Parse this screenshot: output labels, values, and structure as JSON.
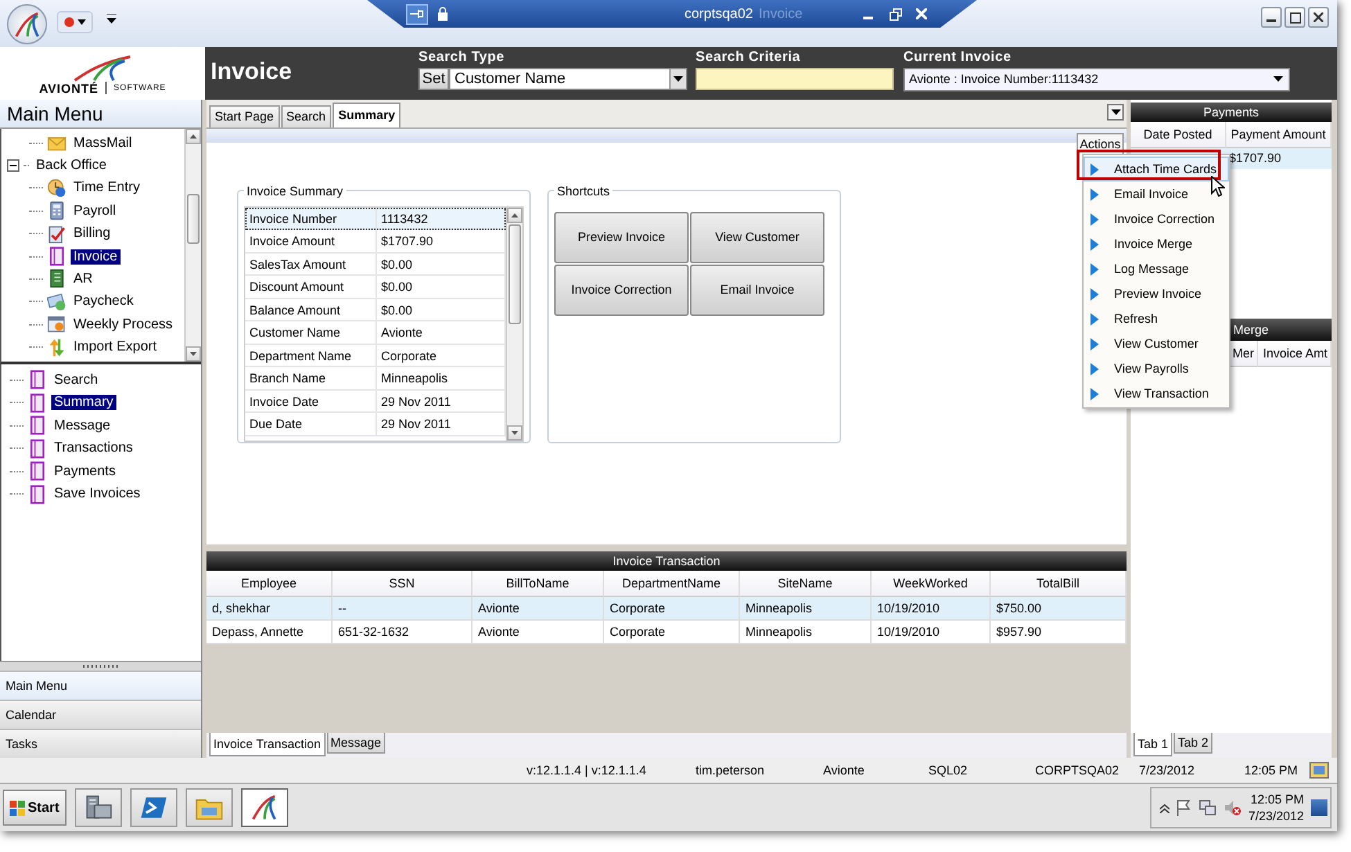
{
  "title_bar": {
    "host": "corptsqa02",
    "document": "Invoice"
  },
  "header": {
    "brand": "AVIONTÉ",
    "tagline": "SOFTWARE",
    "title": "Invoice",
    "search_type": {
      "label": "Search Type",
      "button": "Set",
      "value": "Customer Name"
    },
    "search_criteria": {
      "label": "Search Criteria"
    },
    "current_invoice": {
      "label": "Current Invoice",
      "value": "Avionte : Invoice Number:1113432"
    }
  },
  "sidebar": {
    "title": "Main Menu",
    "tree": [
      {
        "label": "MassMail",
        "kind": "mail",
        "selected": false
      },
      {
        "label": "Back Office",
        "expanded": true,
        "selected": false,
        "children": [
          {
            "label": "Time Entry",
            "kind": "clock",
            "selected": false
          },
          {
            "label": "Payroll",
            "kind": "calculator",
            "selected": false
          },
          {
            "label": "Billing",
            "kind": "check",
            "selected": false
          },
          {
            "label": "Invoice",
            "kind": "document",
            "selected": true
          },
          {
            "label": "AR",
            "kind": "ledger",
            "selected": false
          },
          {
            "label": "Paycheck",
            "kind": "cheque",
            "selected": false
          },
          {
            "label": "Weekly Process",
            "kind": "calendar",
            "selected": false
          },
          {
            "label": "Import Export",
            "kind": "arrows",
            "selected": false
          }
        ]
      }
    ],
    "subtree": [
      {
        "label": "Search",
        "selected": false
      },
      {
        "label": "Summary",
        "selected": true
      },
      {
        "label": "Message",
        "selected": false
      },
      {
        "label": "Transactions",
        "selected": false
      },
      {
        "label": "Payments",
        "selected": false
      },
      {
        "label": "Save Invoices",
        "selected": false
      }
    ],
    "nav": [
      {
        "label": "Main Menu",
        "selected": true
      },
      {
        "label": "Calendar",
        "selected": false
      },
      {
        "label": "Tasks",
        "selected": false
      }
    ]
  },
  "tabs": [
    {
      "label": "Start Page",
      "selected": false
    },
    {
      "label": "Search",
      "selected": false
    },
    {
      "label": "Summary",
      "selected": true
    }
  ],
  "invoice_summary": {
    "title": "Invoice Summary",
    "rows": [
      {
        "label": "Invoice Number",
        "value": "1113432",
        "selected": true
      },
      {
        "label": "Invoice Amount",
        "value": "$1707.90",
        "selected": false
      },
      {
        "label": "SalesTax Amount",
        "value": "$0.00",
        "selected": false
      },
      {
        "label": "Discount Amount",
        "value": "$0.00",
        "selected": false
      },
      {
        "label": "Balance Amount",
        "value": "$0.00",
        "selected": false
      },
      {
        "label": "Customer Name",
        "value": "Avionte",
        "selected": false
      },
      {
        "label": "Department Name",
        "value": "Corporate",
        "selected": false
      },
      {
        "label": "Branch Name",
        "value": "Minneapolis",
        "selected": false
      },
      {
        "label": "Invoice Date",
        "value": "29 Nov 2011",
        "selected": false
      },
      {
        "label": "Due Date",
        "value": "29 Nov 2011",
        "selected": false
      }
    ]
  },
  "shortcuts": {
    "title": "Shortcuts",
    "buttons": [
      "Preview Invoice",
      "View Customer",
      "Invoice Correction",
      "Email Invoice"
    ]
  },
  "actions_menu": {
    "label": "Actions",
    "items": [
      {
        "label": "Attach Time Cards",
        "selected": true
      },
      {
        "label": "Email Invoice",
        "selected": false
      },
      {
        "label": "Invoice Correction",
        "selected": false
      },
      {
        "label": "Invoice Merge",
        "selected": false
      },
      {
        "label": "Log Message",
        "selected": false
      },
      {
        "label": "Preview Invoice",
        "selected": false
      },
      {
        "label": "Refresh",
        "selected": false
      },
      {
        "label": "View Customer",
        "selected": false
      },
      {
        "label": "View Payrolls",
        "selected": false
      },
      {
        "label": "View Transaction",
        "selected": false
      }
    ]
  },
  "transactions": {
    "title": "Invoice Transaction",
    "columns": [
      "Employee",
      "SSN",
      "BillToName",
      "DepartmentName",
      "SiteName",
      "WeekWorked",
      "TotalBill"
    ],
    "rows": [
      {
        "cells": [
          "d, shekhar",
          "--",
          "Avionte",
          "Corporate",
          "Minneapolis",
          "10/19/2010",
          "$750.00"
        ],
        "selected": true
      },
      {
        "cells": [
          "Depass, Annette",
          "651-32-1632",
          "Avionte",
          "Corporate",
          "Minneapolis",
          "10/19/2010",
          "$957.90"
        ],
        "selected": false
      }
    ]
  },
  "bottom_tabs": [
    {
      "label": "Invoice Transaction",
      "selected": true
    },
    {
      "label": "Message",
      "selected": false
    }
  ],
  "payments": {
    "title": "Payments",
    "columns": [
      "Date Posted",
      "Payment Amount"
    ],
    "rows": [
      {
        "payment_amount": "$1707.90",
        "selected": true
      }
    ]
  },
  "merge": {
    "title": "Merge",
    "columns": [
      "Mer",
      "Invoice Amt"
    ]
  },
  "right_tabs": [
    {
      "label": "Tab 1",
      "selected": true
    },
    {
      "label": "Tab 2",
      "selected": false
    }
  ],
  "status_bar": {
    "version": "v:12.1.1.4 | v:12.1.1.4",
    "user": "tim.peterson",
    "company": "Avionte",
    "database": "SQL02",
    "server": "CORPTSQA02",
    "date": "7/23/2012",
    "time": "12:05 PM"
  },
  "taskbar": {
    "start": "Start",
    "apps": [
      {
        "kind": "server",
        "selected": false
      },
      {
        "kind": "shell",
        "selected": false
      },
      {
        "kind": "folder",
        "selected": false
      },
      {
        "kind": "logo",
        "selected": true
      }
    ],
    "clock": {
      "time": "12:05 PM",
      "date": "7/23/2012"
    }
  }
}
